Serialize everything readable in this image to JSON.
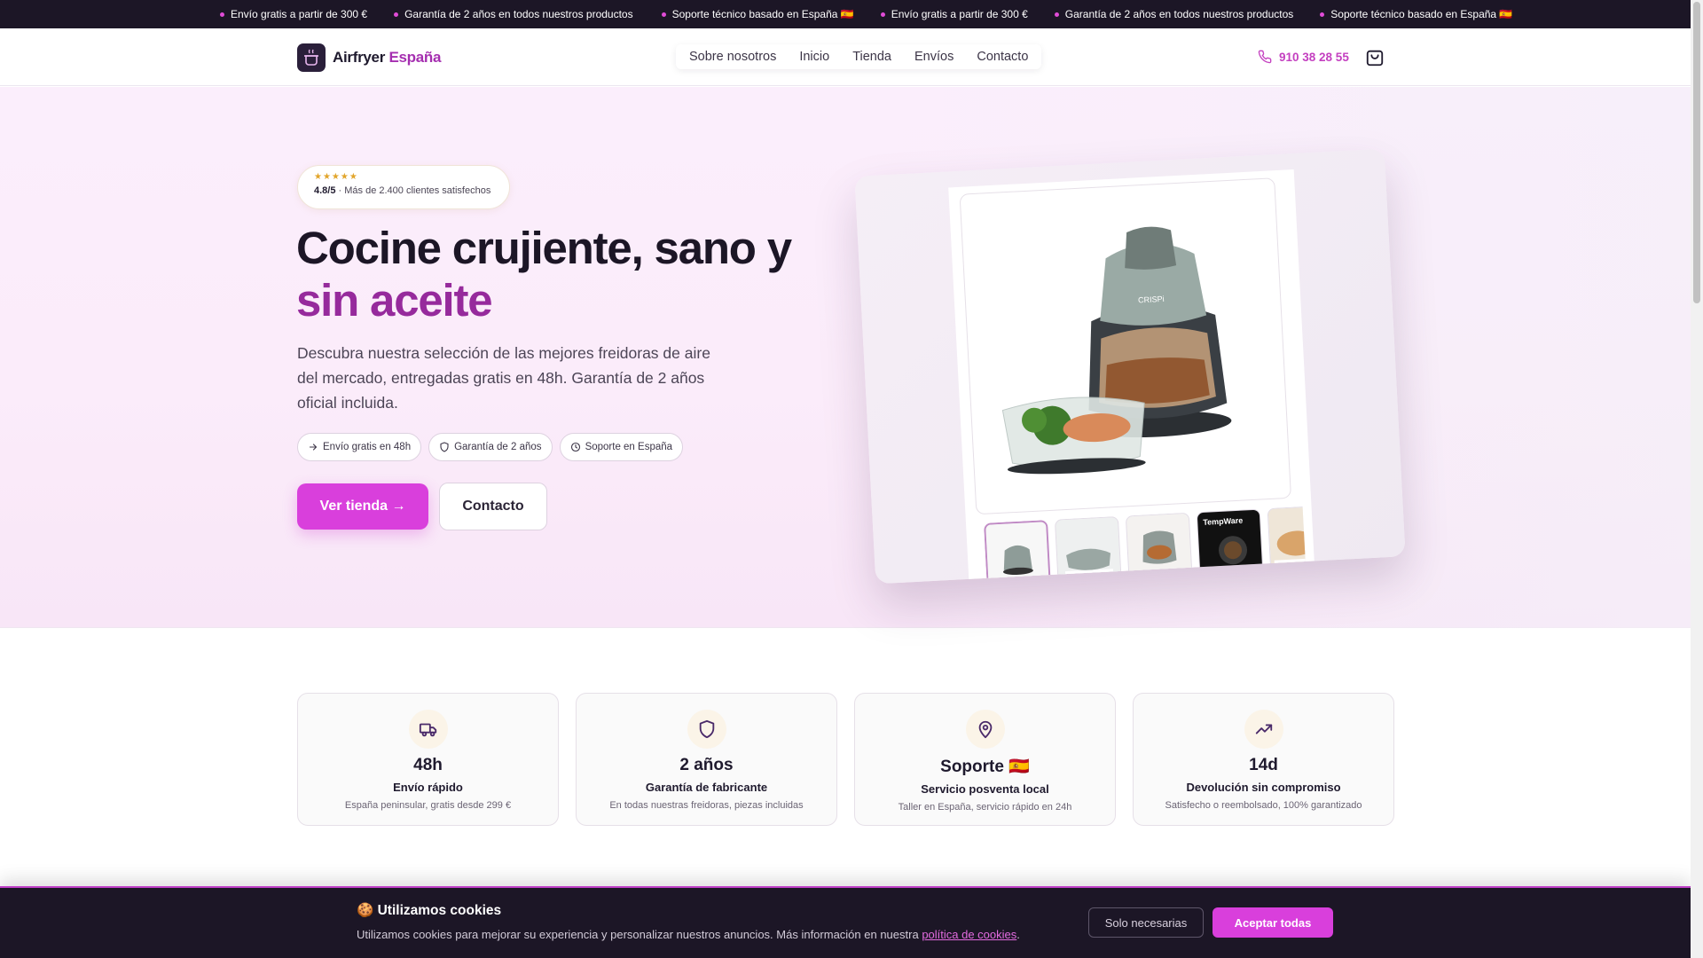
{
  "announcement": {
    "items": [
      "Envío gratis a partir de 300 €",
      "Garantía de 2 años en todos nuestros productos",
      "Soporte técnico basado en España 🇪🇸",
      "Envío gratis a partir de 300 €",
      "Garantía de 2 años en todos nuestros productos",
      "Soporte técnico basado en España 🇪🇸"
    ]
  },
  "header": {
    "brand_main": "Airfryer",
    "brand_accent": "España",
    "nav": [
      "Sobre nosotros",
      "Inicio",
      "Tienda",
      "Envíos",
      "Contacto"
    ],
    "phone": "910 38 28 55",
    "icons": {
      "phone": "phone-icon",
      "cart": "shopping-bag-icon",
      "logo": "cooking-pot-icon"
    }
  },
  "hero": {
    "rating_stars": "★★★★★",
    "rating_score": "4.8/5",
    "rating_text": " · Más de 2.400 clientes satisfechos",
    "title_line1": "Cocine crujiente, sano y",
    "title_accent": "sin aceite",
    "lead": "Descubra nuestra selección de las mejores freidoras de aire del mercado, entregadas gratis en 48h. Garantía de 2 años oficial incluida.",
    "chips": [
      {
        "label": "Envío gratis en 48h",
        "icon": "arrow-right-icon"
      },
      {
        "label": "Garantía de 2 años",
        "icon": "shield-icon"
      },
      {
        "label": "Soporte en España",
        "icon": "clock-icon"
      }
    ],
    "cta_primary": "Ver tienda →",
    "cta_secondary": "Contacto",
    "product_thumbs": [
      "",
      "",
      "",
      "TempWare",
      ""
    ]
  },
  "features": [
    {
      "value": "48h",
      "title": "Envío rápido",
      "desc": "España peninsular, gratis desde 299 €",
      "icon": "truck-icon"
    },
    {
      "value": "2 años",
      "title": "Garantía de fabricante",
      "desc": "En todas nuestras freidoras, piezas incluidas",
      "icon": "shield-icon"
    },
    {
      "value": "Soporte 🇪🇸",
      "title": "Servicio posventa local",
      "desc": "Taller en España, servicio rápido en 24h",
      "icon": "map-pin-icon"
    },
    {
      "value": "14d",
      "title": "Devolución sin compromiso",
      "desc": "Satisfecho o reembolsado, 100% garantizado",
      "icon": "trending-up-icon"
    }
  ],
  "cookie": {
    "title": "🍪 Utilizamos cookies",
    "text": "Utilizamos cookies para mejorar su experiencia y personalizar nuestros anuncios. Más información en nuestra ",
    "link": "política de cookies",
    "text_end": ".",
    "btn_necessary": "Solo necesarias",
    "btn_accept": "Aceptar todas"
  },
  "colors": {
    "accent": "#d93fdc",
    "brand_purple": "#962a9c",
    "dark": "#1c1626"
  }
}
